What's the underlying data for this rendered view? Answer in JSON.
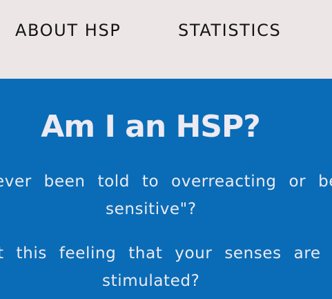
{
  "nav": {
    "items": [
      {
        "label": "ABOUT HSP"
      },
      {
        "label": "STATISTICS"
      }
    ]
  },
  "hero": {
    "title": "Am I an HSP?",
    "question1_line1": "ever been told to overreacting or bei",
    "question1_line2": "sensitive\"?",
    "question2_line1": "t this feeling that your senses are co",
    "question2_line2": "stimulated?"
  },
  "colors": {
    "nav_background": "#ede6e6",
    "hero_background": "#0a6cb6",
    "hero_text": "#eceaf2",
    "nav_text": "#141414"
  }
}
